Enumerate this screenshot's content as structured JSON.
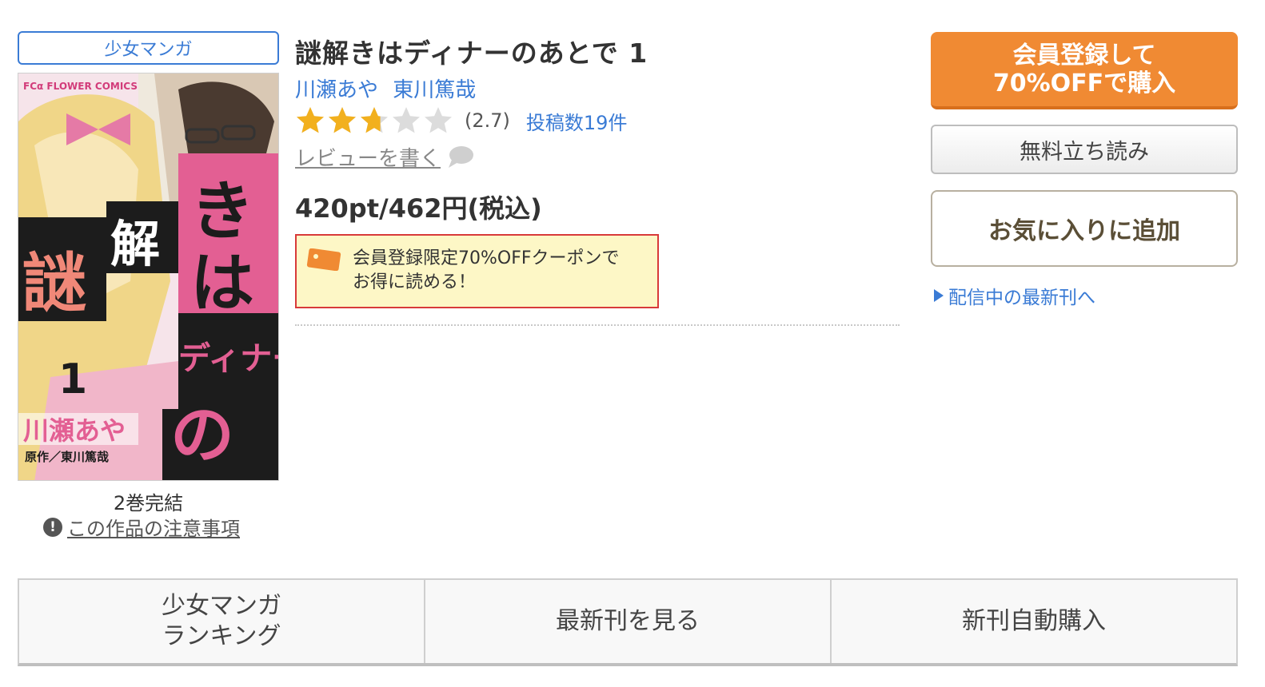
{
  "genre_badge": "少女マンガ",
  "cover": {
    "publisher_mark": "FCα FLOWER COMICS",
    "title_art": "謎解きはディナーのあとで",
    "volume": "1",
    "author_art": "川瀬あや",
    "credit_art": "原作／東川篤哉"
  },
  "series_status": "2巻完結",
  "notice_link": "この作品の注意事項",
  "title": "謎解きはディナーのあとで 1",
  "authors": [
    "川瀬あや",
    "東川篤哉"
  ],
  "rating": {
    "value": 2.7,
    "value_text": "(2.7)",
    "review_count": "投稿数19件",
    "star_count": 5
  },
  "write_review": "レビューを書く",
  "price": "420pt/462円(税込)",
  "coupon_text": "会員登録限定70%OFFクーポンで\nお得に読める！",
  "buttons": {
    "buy": "会員登録して\n70%OFFで購入",
    "trial": "無料立ち読み",
    "favorite": "お気に入りに追加"
  },
  "latest_link": "配信中の最新刊へ",
  "bottom_tabs": [
    "少女マンガ\nランキング",
    "最新刊を見る",
    "新刊自動購入"
  ],
  "colors": {
    "accent_blue": "#3a7bd5",
    "buy_orange": "#f08a33",
    "star_gold": "#f2b01e",
    "coupon_border": "#d83a3a",
    "coupon_bg": "#fdf7c6"
  }
}
